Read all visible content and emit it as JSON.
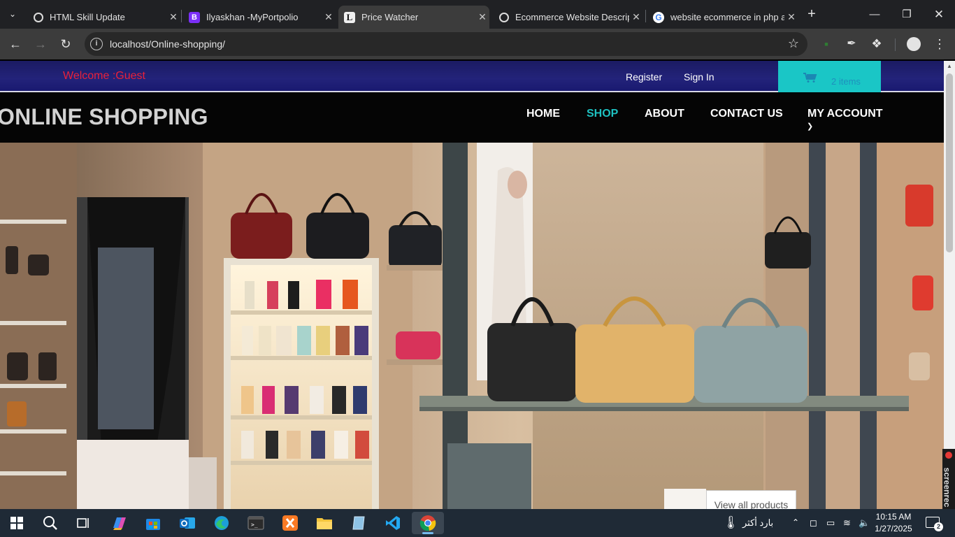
{
  "browser": {
    "tabs": [
      {
        "title": "HTML Skill Update",
        "icon": "chatgpt-icon"
      },
      {
        "title": "Ilyaskhan -MyPortpolio",
        "icon": "bootstrap-icon"
      },
      {
        "title": "Price Watcher",
        "icon": "letter-l-icon",
        "active": true
      },
      {
        "title": "Ecommerce Website Descrip",
        "icon": "chatgpt-icon"
      },
      {
        "title": "website ecommerce in php a",
        "icon": "google-icon"
      }
    ],
    "address": "localhost/Online-shopping/"
  },
  "site": {
    "welcome": "Welcome :Guest",
    "register": "Register",
    "signin": "Sign In",
    "cart_items": "2 items",
    "brand": "ONLINE SHOPPING",
    "nav": [
      "HOME",
      "SHOP",
      "ABOUT",
      "CONTACT US",
      "MY ACCOUNT"
    ],
    "active_nav": "SHOP",
    "hero_button": "View all products",
    "colors": {
      "accent": "#1ec1c1",
      "welcome": "#e8213b",
      "topbar": "#1f1f6e"
    }
  },
  "recorder": {
    "label": "screenrec"
  },
  "taskbar": {
    "weather": "بارد أكثر",
    "time": "10:15 AM",
    "date": "1/27/2025",
    "notifications": "2"
  }
}
